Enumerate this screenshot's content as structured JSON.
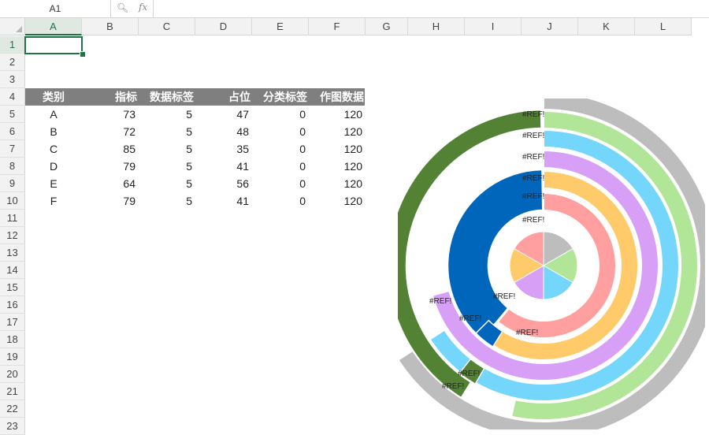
{
  "formula_bar": {
    "name_box": "A1",
    "zoom_icon": "magnifier-icon",
    "fx_label": "fx",
    "formula": ""
  },
  "columns": [
    "A",
    "B",
    "C",
    "D",
    "E",
    "F",
    "G",
    "H",
    "I",
    "J",
    "K",
    "L"
  ],
  "rows": [
    "1",
    "2",
    "3",
    "4",
    "5",
    "6",
    "7",
    "8",
    "9",
    "10",
    "11",
    "12",
    "13",
    "14",
    "15",
    "16",
    "17",
    "18",
    "19",
    "20",
    "21",
    "22",
    "23"
  ],
  "selected_cell": "A1",
  "table": {
    "headers": [
      "类别",
      "指标",
      "数据标签",
      "占位",
      "分类标签",
      "作图数据"
    ],
    "rows": [
      [
        "A",
        "73",
        "5",
        "47",
        "0",
        "120"
      ],
      [
        "B",
        "72",
        "5",
        "48",
        "0",
        "120"
      ],
      [
        "C",
        "85",
        "5",
        "35",
        "0",
        "120"
      ],
      [
        "D",
        "79",
        "5",
        "41",
        "0",
        "120"
      ],
      [
        "E",
        "64",
        "5",
        "56",
        "0",
        "120"
      ],
      [
        "F",
        "79",
        "5",
        "41",
        "0",
        "120"
      ]
    ]
  },
  "chart_data": {
    "type": "radial-bar",
    "error_label": "#REF!",
    "categories": [
      "A",
      "B",
      "C",
      "D",
      "E",
      "F"
    ],
    "values": [
      73,
      72,
      85,
      79,
      64,
      79
    ],
    "max": 120,
    "colors": [
      "#ff9f9f",
      "#ffca6a",
      "#d79ff5",
      "#73d6fa",
      "#b1e598",
      "#bdbdbd"
    ],
    "band_colors": [
      "#0066bb",
      "#0066bb",
      "#548235",
      "#548235"
    ],
    "pie_colors": [
      "#bdbdbd",
      "#b1e598",
      "#73d6fa",
      "#d79ff5",
      "#ffca6a",
      "#ff9f9f"
    ]
  }
}
